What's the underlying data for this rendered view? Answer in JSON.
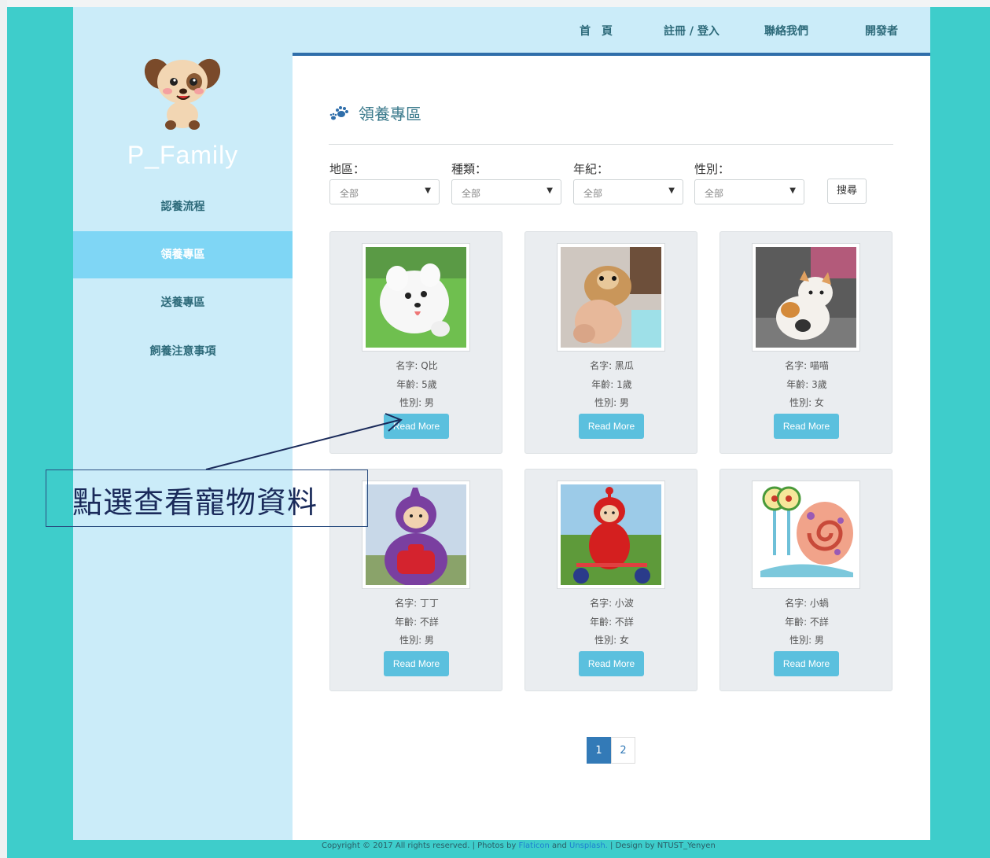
{
  "brand": "P_Family",
  "sidebar": {
    "items": [
      {
        "label": "認養流程"
      },
      {
        "label": "領養專區"
      },
      {
        "label": "送養專區"
      },
      {
        "label": "飼養注意事項"
      }
    ]
  },
  "nav": {
    "home": "首　頁",
    "register": "註冊 / 登入",
    "contact": "聯絡我們",
    "developer": "開發者"
  },
  "page_title": "領養專區",
  "filters": [
    {
      "label": "地區：",
      "value": "全部"
    },
    {
      "label": "種類：",
      "value": "全部"
    },
    {
      "label": "年紀：",
      "value": "全部"
    },
    {
      "label": "性別：",
      "value": "全部"
    }
  ],
  "search_label": "搜尋",
  "pets": [
    {
      "name": "名字: Q比",
      "age": "年齡: 5歲",
      "gender": "性別: 男",
      "button": "Read More"
    },
    {
      "name": "名字: 黑瓜",
      "age": "年齡: 1歲",
      "gender": "性別: 男",
      "button": "Read More"
    },
    {
      "name": "名字: 喵喵",
      "age": "年齡: 3歲",
      "gender": "性別: 女",
      "button": "Read More"
    },
    {
      "name": "名字: 丁丁",
      "age": "年齡: 不詳",
      "gender": "性別: 男",
      "button": "Read More"
    },
    {
      "name": "名字: 小波",
      "age": "年齡: 不詳",
      "gender": "性別: 女",
      "button": "Read More"
    },
    {
      "name": "名字: 小蝸",
      "age": "年齡: 不詳",
      "gender": "性別: 男",
      "button": "Read More"
    }
  ],
  "pagination": [
    "1",
    "2"
  ],
  "footer": {
    "prefix": "Copyright © 2017 All rights reserved. | Photos by ",
    "flaticon": "Flaticon",
    "and": " and ",
    "unsplash": "Unsplash.",
    "suffix": " | Design by NTUST_Yenyen"
  },
  "annotation": "點選查看寵物資料"
}
